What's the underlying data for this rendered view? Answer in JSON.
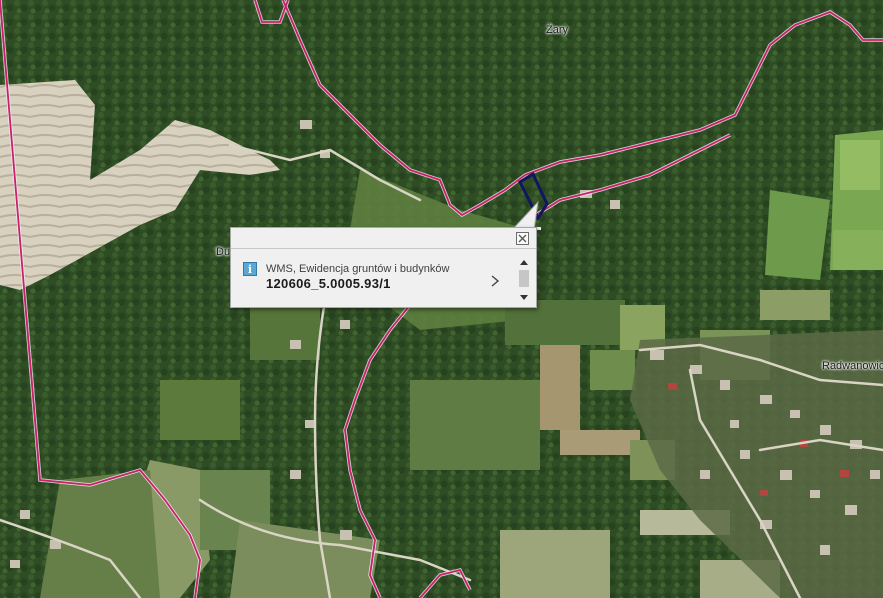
{
  "map": {
    "labels": {
      "zary": "Żary",
      "du": "Du",
      "radwanowice": "Radwanowic"
    },
    "colors": {
      "forest": "#304d25",
      "field": "#6e8f4c",
      "quarry": "#d6cfbd",
      "boundary": "#cc1f6e",
      "parcel": "#101060"
    }
  },
  "popup": {
    "layer_name": "WMS, Ewidencja gruntów i budynków",
    "parcel_id": "120606_5.0005.93/1",
    "info_icon": "i",
    "icons": {
      "close": "close-icon",
      "next": "chevron-right-icon",
      "up": "arrow-up-icon",
      "down": "arrow-down-icon"
    }
  }
}
